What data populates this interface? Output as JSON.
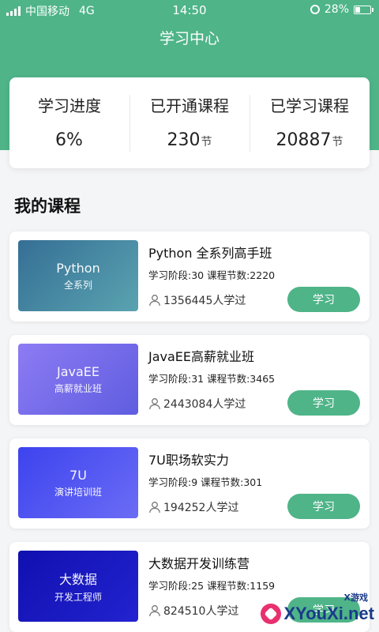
{
  "status_bar": {
    "carrier": "中国移动",
    "network": "4G",
    "time": "14:50",
    "battery": "28%"
  },
  "page_title": "学习中心",
  "stats": [
    {
      "label": "学习进度",
      "value": "6%",
      "unit": ""
    },
    {
      "label": "已开通课程",
      "value": "230",
      "unit": "节"
    },
    {
      "label": "已学习课程",
      "value": "20887",
      "unit": "节"
    }
  ],
  "section_title": "我的课程",
  "courses": [
    {
      "thumb_title": "Python",
      "thumb_sub": "全系列",
      "title": "Python 全系列高手班",
      "meta": "学习阶段:30 课程节数:2220",
      "learners": "1356445人学过",
      "button": "学习",
      "thumb_color": "#3f7fa0"
    },
    {
      "thumb_title": "JavaEE",
      "thumb_sub": "高薪就业班",
      "title": "JavaEE高薪就业班",
      "meta": "学习阶段:31 课程节数:3465",
      "learners": "2443084人学过",
      "button": "学习",
      "thumb_color": "#7a6ff0"
    },
    {
      "thumb_title": "7U",
      "thumb_sub": "演讲培训班",
      "title": "7U职场软实力",
      "meta": "学习阶段:9 课程节数:301",
      "learners": "194252人学过",
      "button": "学习",
      "thumb_color": "#4a55f0"
    },
    {
      "thumb_title": "大数据",
      "thumb_sub": "开发工程师",
      "title": "大数据开发训练营",
      "meta": "学习阶段:25 课程节数:1159",
      "learners": "824510人学过",
      "button": "学习",
      "thumb_color": "#1a1ac0"
    }
  ],
  "watermark": {
    "small": "X游戏",
    "text": "XYouXi.net"
  },
  "colors": {
    "accent": "#4fb488"
  }
}
